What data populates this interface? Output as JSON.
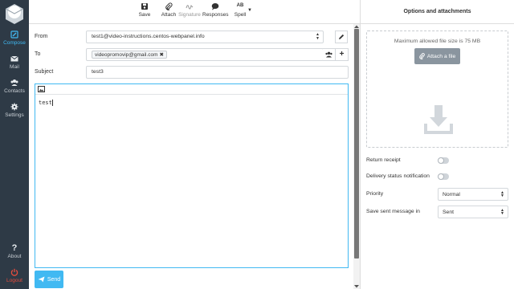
{
  "nav": {
    "items": [
      {
        "label": "Compose",
        "icon": "pencil-icon",
        "active": true
      },
      {
        "label": "Mail",
        "icon": "envelope-icon"
      },
      {
        "label": "Contacts",
        "icon": "users-icon"
      },
      {
        "label": "Settings",
        "icon": "gear-icon"
      }
    ],
    "about": "About",
    "logout": "Logout"
  },
  "toolbar": {
    "save": "Save",
    "attach": "Attach",
    "signature": "Signature",
    "responses": "Responses",
    "spell": "Spell",
    "spell_icon_text": "AB"
  },
  "form": {
    "from_label": "From",
    "from_value": "test1@video-instructions.centos-webpanel.info",
    "to_label": "To",
    "to_recipient": "videopromovip@gmail.com",
    "subject_label": "Subject",
    "subject_value": "test3",
    "body": "test"
  },
  "send_label": "Send",
  "panel": {
    "title": "Options and attachments",
    "max_size": "Maximum allowed file size is 75 MB",
    "attach_file": "Attach a file",
    "return_receipt": "Return receipt",
    "delivery_status": "Delivery status notification",
    "priority_label": "Priority",
    "priority_value": "Normal",
    "save_sent_label": "Save sent message in",
    "save_sent_value": "Sent"
  },
  "colors": {
    "accent": "#41b9f2",
    "nav_bg": "#2e3a46",
    "logout": "#e74c3c"
  }
}
